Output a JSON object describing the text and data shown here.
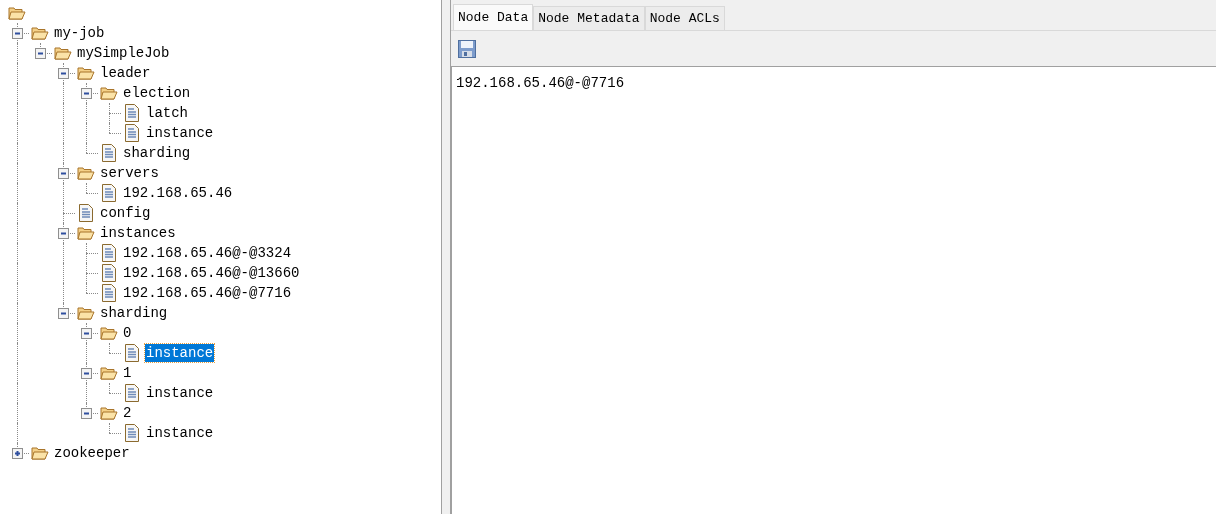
{
  "tree": {
    "kind": "folder",
    "children": [
      {
        "label": "my-job",
        "kind": "folder",
        "expanded": true,
        "selected": false,
        "children": [
          {
            "label": "mySimpleJob",
            "kind": "folder",
            "expanded": true,
            "selected": false,
            "children": [
              {
                "label": "leader",
                "kind": "folder",
                "expanded": true,
                "selected": false,
                "children": [
                  {
                    "label": "election",
                    "kind": "folder",
                    "expanded": true,
                    "selected": false,
                    "children": [
                      {
                        "label": "latch",
                        "kind": "file",
                        "selected": false
                      },
                      {
                        "label": "instance",
                        "kind": "file",
                        "selected": false
                      }
                    ]
                  },
                  {
                    "label": "sharding",
                    "kind": "file",
                    "selected": false
                  }
                ]
              },
              {
                "label": "servers",
                "kind": "folder",
                "expanded": true,
                "selected": false,
                "children": [
                  {
                    "label": "192.168.65.46",
                    "kind": "file",
                    "selected": false
                  }
                ]
              },
              {
                "label": "config",
                "kind": "file",
                "selected": false
              },
              {
                "label": "instances",
                "kind": "folder",
                "expanded": true,
                "selected": false,
                "children": [
                  {
                    "label": "192.168.65.46@-@3324",
                    "kind": "file",
                    "selected": false
                  },
                  {
                    "label": "192.168.65.46@-@13660",
                    "kind": "file",
                    "selected": false
                  },
                  {
                    "label": "192.168.65.46@-@7716",
                    "kind": "file",
                    "selected": false
                  }
                ]
              },
              {
                "label": "sharding",
                "kind": "folder",
                "expanded": true,
                "selected": false,
                "children": [
                  {
                    "label": "0",
                    "kind": "folder",
                    "expanded": true,
                    "selected": false,
                    "children": [
                      {
                        "label": "instance",
                        "kind": "file",
                        "selected": true
                      }
                    ]
                  },
                  {
                    "label": "1",
                    "kind": "folder",
                    "expanded": true,
                    "selected": false,
                    "children": [
                      {
                        "label": "instance",
                        "kind": "file",
                        "selected": false
                      }
                    ]
                  },
                  {
                    "label": "2",
                    "kind": "folder",
                    "expanded": true,
                    "selected": false,
                    "children": [
                      {
                        "label": "instance",
                        "kind": "file",
                        "selected": false
                      }
                    ]
                  }
                ]
              }
            ]
          }
        ]
      },
      {
        "label": "zookeeper",
        "kind": "folder",
        "expanded": false,
        "selected": false
      }
    ]
  },
  "tabs": [
    {
      "label": "Node Data",
      "selected": true
    },
    {
      "label": "Node Metadata",
      "selected": false
    },
    {
      "label": "Node ACLs",
      "selected": false
    }
  ],
  "node_data": "192.168.65.46@-@7716"
}
